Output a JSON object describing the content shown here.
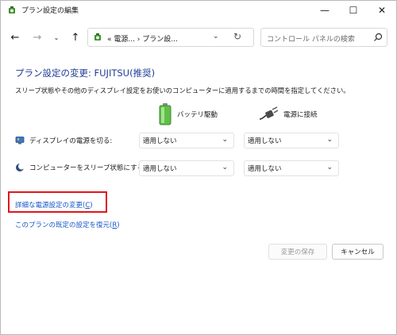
{
  "window": {
    "title": "プラン設定の編集",
    "icon": "power-options-icon"
  },
  "titlebar": {
    "minimize_icon": "minimize-icon",
    "maximize_icon": "maximize-icon",
    "close_icon": "close-icon",
    "minimize_glyph": "—",
    "maximize_glyph": "☐",
    "close_glyph": "✕"
  },
  "nav": {
    "back_glyph": "←",
    "forward_glyph": "→",
    "recent_glyph": "⌄",
    "up_glyph": "↑",
    "address_path": "« 電源... › プラン設...",
    "address_chevron": "⌄",
    "refresh_glyph": "↻",
    "search_placeholder": "コントロール パネルの検索"
  },
  "content": {
    "heading": "プラン設定の変更: FUJITSU(推奨)",
    "description": "スリープ状態やその他のディスプレイ設定をお使いのコンピューターに適用するまでの時間を指定してください。",
    "columns": {
      "battery": "バッテリ駆動",
      "plugged_in": "電源に接続"
    },
    "settings": [
      {
        "label": "ディスプレイの電源を切る:",
        "icon": "monitor-icon",
        "battery_value": "適用しない",
        "plugged_value": "適用しない"
      },
      {
        "label": "コンピューターをスリープ状態にする:",
        "icon": "moon-icon",
        "battery_value": "適用しない",
        "plugged_value": "適用しない"
      }
    ],
    "links": {
      "advanced": "詳細な電源設定の変更(",
      "advanced_key": "C",
      "advanced_end": ")",
      "restore": "このプランの既定の設定を復元(",
      "restore_key": "R",
      "restore_end": ")"
    }
  },
  "buttons": {
    "save": "変更の保存",
    "cancel": "キャンセル"
  },
  "colors": {
    "heading": "#1e3c96",
    "link": "#1756c7",
    "highlight_border": "#e0161d",
    "battery_green": "#4caf3c"
  }
}
